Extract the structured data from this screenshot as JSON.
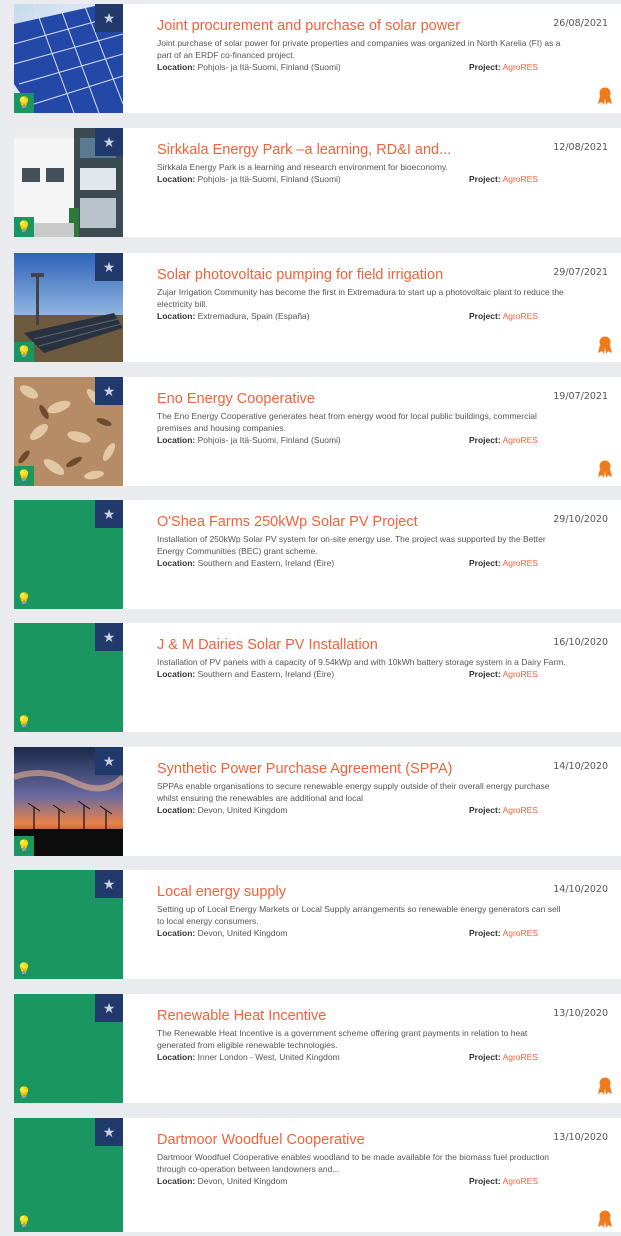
{
  "colors": {
    "title": "#f0623a",
    "green": "#1a9660",
    "navy": "#213a6b"
  },
  "location_label": "Location:",
  "project_label": "Project:",
  "items": [
    {
      "title": "Joint procurement and purchase of solar power",
      "date": "26/08/2021",
      "description": "Joint purchase of solar power for private properties and companies was organized in North Karelia (FI) as a part of an ERDF co-financed project.",
      "location": "Pohjois- ja Itä-Suomi, Finland (Suomi)",
      "project": "AgroRES",
      "thumbnail": "solar-panel-image",
      "award": true
    },
    {
      "title": "Sirkkala Energy Park –a learning, RD&I and...",
      "date": "12/08/2021",
      "description": "Sirkkala Energy Park is a learning and research environment for bioeconomy.",
      "location": "Pohjois- ja Itä-Suomi, Finland (Suomi)",
      "project": "AgroRES",
      "thumbnail": "building-image",
      "award": false
    },
    {
      "title": "Solar photovoltaic pumping for field irrigation",
      "date": "29/07/2021",
      "description": "Zujar Irrigation Community has become the first in Extremadura to start up a photovoltaic plant to reduce the electricity bill.",
      "location": "Extremadura, Spain (España)",
      "project": "AgroRES",
      "thumbnail": "pv-field-image",
      "award": true
    },
    {
      "title": "Eno Energy Cooperative",
      "date": "19/07/2021",
      "description": "The Eno Energy Cooperative generates heat from energy wood for local public buildings, commercial premises and housing companies.",
      "location": "Pohjois- ja Itä-Suomi, Finland (Suomi)",
      "project": "AgroRES",
      "thumbnail": "wood-chips-image",
      "award": true
    },
    {
      "title": "O'Shea Farms 250kWp Solar PV Project",
      "date": "29/10/2020",
      "description": "Installation of 250kWp Solar PV system for on-site energy use. The project was supported by the Better Energy Communities (BEC) grant scheme.",
      "location": "Southern and Eastern, Ireland (Éire)",
      "project": "AgroRES",
      "thumbnail": "placeholder",
      "award": false
    },
    {
      "title": "J & M Dairies Solar PV Installation",
      "date": "16/10/2020",
      "description": "Installation of PV panels with a capacity of 9.54kWp and with 10kWh battery storage system in a Dairy Farm.",
      "location": "Southern and Eastern, Ireland (Éire)",
      "project": "AgroRES",
      "thumbnail": "placeholder",
      "award": false
    },
    {
      "title": "Synthetic Power Purchase Agreement (SPPA)",
      "date": "14/10/2020",
      "description": "SPPAs enable organisations to secure renewable energy supply outside of their overall energy purchase whilst ensuring the renewables are additional and local",
      "location": "Devon, United Kingdom",
      "project": "AgroRES",
      "thumbnail": "wind-sunset-image",
      "award": false
    },
    {
      "title": "Local energy supply",
      "date": "14/10/2020",
      "description": "Setting up of Local Energy Markets or Local Supply arrangements so renewable energy generators can sell to local energy consumers.",
      "location": "Devon, United Kingdom",
      "project": "AgroRES",
      "thumbnail": "placeholder",
      "award": false
    },
    {
      "title": "Renewable Heat Incentive",
      "date": "13/10/2020",
      "description": "The Renewable Heat Incentive is a government scheme offering grant payments in relation to heat generated from eligible renewable technologies.",
      "location": "Inner London - West, United Kingdom",
      "project": "AgroRES",
      "thumbnail": "placeholder",
      "award": true
    },
    {
      "title": "Dartmoor Woodfuel Cooperative",
      "date": "13/10/2020",
      "description": "Dartmoor Woodfuel Cooperative enables woodland to be made available for the biomass fuel production through co-operation between landowners and...",
      "location": "Devon, United Kingdom",
      "project": "AgroRES",
      "thumbnail": "placeholder",
      "award": true
    }
  ]
}
